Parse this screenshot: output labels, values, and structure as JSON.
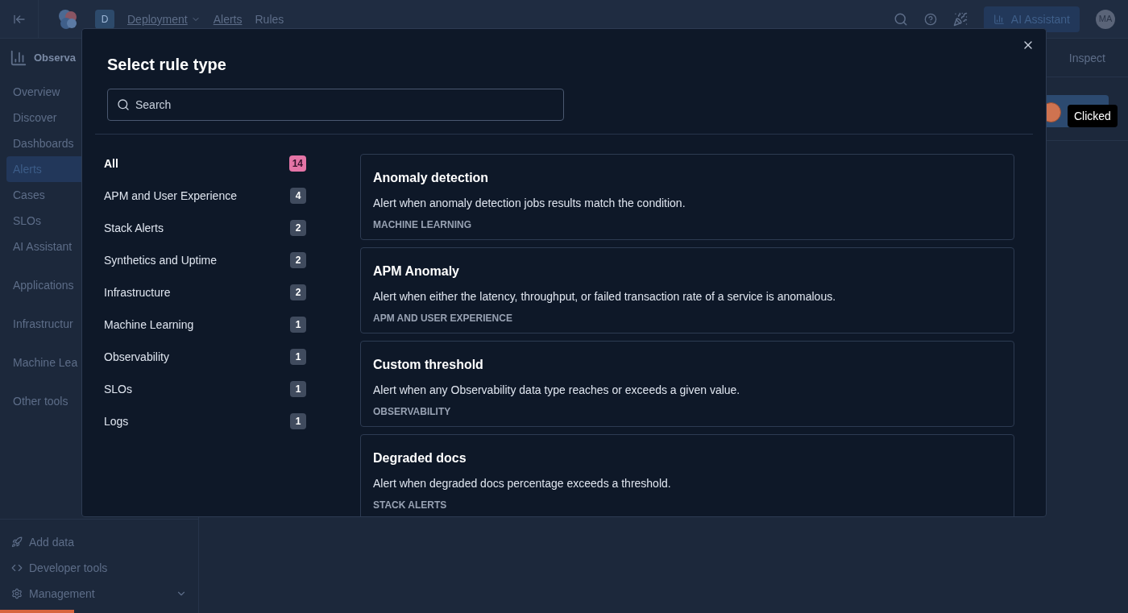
{
  "header": {
    "deployment_badge": "D",
    "breadcrumbs": [
      {
        "label": "Deployment",
        "kind": "dropdown"
      },
      {
        "label": "Alerts",
        "kind": "link"
      },
      {
        "label": "Rules",
        "kind": "current"
      }
    ],
    "ai_button": "AI Assistant",
    "avatar": "MA"
  },
  "sidebar": {
    "title": "Observa",
    "items": [
      {
        "label": "Overview",
        "kind": "link",
        "selected": false
      },
      {
        "label": "Discover",
        "kind": "link",
        "selected": false
      },
      {
        "label": "Dashboards",
        "kind": "link",
        "selected": false
      },
      {
        "label": "Alerts",
        "kind": "link",
        "selected": true
      },
      {
        "label": "Cases",
        "kind": "link",
        "selected": false
      },
      {
        "label": "SLOs",
        "kind": "link",
        "selected": false
      },
      {
        "label": "AI Assistant",
        "kind": "link",
        "selected": false
      },
      {
        "label": "Applications",
        "kind": "section",
        "selected": false
      },
      {
        "label": "Infrastructur",
        "kind": "section",
        "selected": false
      },
      {
        "label": "Machine Lea",
        "kind": "section",
        "selected": false
      },
      {
        "label": "Other tools",
        "kind": "section",
        "selected": false
      }
    ],
    "footer": [
      {
        "label": "Add data",
        "has_menu": false
      },
      {
        "label": "Developer tools",
        "has_menu": false
      },
      {
        "label": "Management",
        "has_menu": true
      }
    ]
  },
  "page": {
    "tabs": [
      "Inspect"
    ],
    "tooltip": "Clicked"
  },
  "loading_bar": {
    "level": 0.066
  },
  "modal": {
    "title": "Select rule type",
    "search": {
      "placeholder": "Search"
    },
    "categories": [
      {
        "label": "All",
        "count": "14",
        "selected": true
      },
      {
        "label": "APM and User Experience",
        "count": "4",
        "selected": false
      },
      {
        "label": "Stack Alerts",
        "count": "2",
        "selected": false
      },
      {
        "label": "Synthetics and Uptime",
        "count": "2",
        "selected": false
      },
      {
        "label": "Infrastructure",
        "count": "2",
        "selected": false
      },
      {
        "label": "Machine Learning",
        "count": "1",
        "selected": false
      },
      {
        "label": "Observability",
        "count": "1",
        "selected": false
      },
      {
        "label": "SLOs",
        "count": "1",
        "selected": false
      },
      {
        "label": "Logs",
        "count": "1",
        "selected": false
      }
    ],
    "rule_types": [
      {
        "title": "Anomaly detection",
        "description": "Alert when anomaly detection jobs results match the condition.",
        "category": "MACHINE LEARNING"
      },
      {
        "title": "APM Anomaly",
        "description": "Alert when either the latency, throughput, or failed transaction rate of a service is anomalous.",
        "category": "APM AND USER EXPERIENCE"
      },
      {
        "title": "Custom threshold",
        "description": "Alert when any Observability data type reaches or exceeds a given value.",
        "category": "OBSERVABILITY"
      },
      {
        "title": "Degraded docs",
        "description": "Alert when degraded docs percentage exceeds a threshold.",
        "category": "STACK ALERTS"
      }
    ]
  }
}
